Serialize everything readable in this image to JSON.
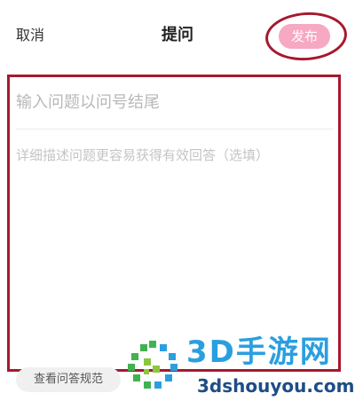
{
  "header": {
    "cancel_label": "取消",
    "title": "提问",
    "publish_label": "发布"
  },
  "form": {
    "question_placeholder": "输入问题以问号结尾",
    "detail_placeholder": "详细描述问题更容易获得有效回答（选填）"
  },
  "footer": {
    "rules_label": "查看问答规范"
  },
  "watermark": {
    "title": "3D手游网",
    "url": "3dshouyou.com"
  },
  "colors": {
    "accent_pink": "#f7a8c3",
    "highlight_red": "#a6192e",
    "watermark_blue": "#2a9fe0",
    "watermark_green": "#3fb34f"
  }
}
